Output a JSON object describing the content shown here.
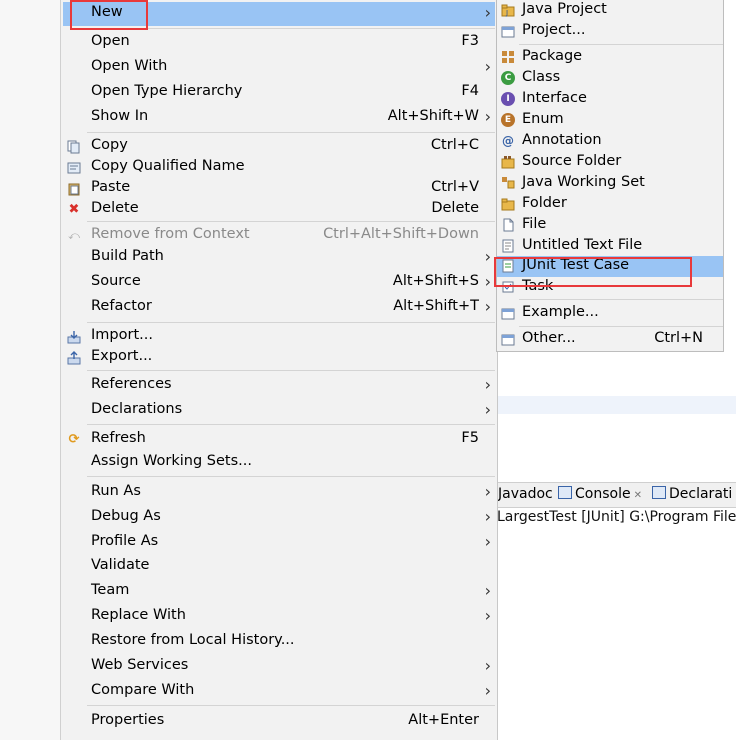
{
  "menu": {
    "items": [
      {
        "label": "New",
        "accel": "",
        "arrow": true,
        "icon": "",
        "highlight": true
      },
      {
        "label": "Open",
        "accel": "F3",
        "arrow": false,
        "icon": ""
      },
      {
        "label": "Open With",
        "accel": "",
        "arrow": true,
        "icon": ""
      },
      {
        "label": "Open Type Hierarchy",
        "accel": "F4",
        "arrow": false,
        "icon": ""
      },
      {
        "label": "Show In",
        "accel": "Alt+Shift+W",
        "arrow": true,
        "icon": ""
      },
      {
        "label": "Copy",
        "accel": "Ctrl+C",
        "arrow": false,
        "icon": "copy-icon"
      },
      {
        "label": "Copy Qualified Name",
        "accel": "",
        "arrow": false,
        "icon": "copy-qualified-name-icon"
      },
      {
        "label": "Paste",
        "accel": "Ctrl+V",
        "arrow": false,
        "icon": "paste-icon"
      },
      {
        "label": "Delete",
        "accel": "Delete",
        "arrow": false,
        "icon": "delete-icon"
      },
      {
        "label": "Remove from Context",
        "accel": "Ctrl+Alt+Shift+Down",
        "arrow": false,
        "icon": "remove-context-icon",
        "disabled": true
      },
      {
        "label": "Build Path",
        "accel": "",
        "arrow": true,
        "icon": ""
      },
      {
        "label": "Source",
        "accel": "Alt+Shift+S",
        "arrow": true,
        "icon": ""
      },
      {
        "label": "Refactor",
        "accel": "Alt+Shift+T",
        "arrow": true,
        "icon": ""
      },
      {
        "label": "Import...",
        "accel": "",
        "arrow": false,
        "icon": "import-icon"
      },
      {
        "label": "Export...",
        "accel": "",
        "arrow": false,
        "icon": "export-icon"
      },
      {
        "label": "References",
        "accel": "",
        "arrow": true,
        "icon": ""
      },
      {
        "label": "Declarations",
        "accel": "",
        "arrow": true,
        "icon": ""
      },
      {
        "label": "Refresh",
        "accel": "F5",
        "arrow": false,
        "icon": "refresh-icon"
      },
      {
        "label": "Assign Working Sets...",
        "accel": "",
        "arrow": false,
        "icon": ""
      },
      {
        "label": "Run As",
        "accel": "",
        "arrow": true,
        "icon": ""
      },
      {
        "label": "Debug As",
        "accel": "",
        "arrow": true,
        "icon": ""
      },
      {
        "label": "Profile As",
        "accel": "",
        "arrow": true,
        "icon": ""
      },
      {
        "label": "Validate",
        "accel": "",
        "arrow": false,
        "icon": ""
      },
      {
        "label": "Team",
        "accel": "",
        "arrow": true,
        "icon": ""
      },
      {
        "label": "Replace With",
        "accel": "",
        "arrow": true,
        "icon": ""
      },
      {
        "label": "Restore from Local History...",
        "accel": "",
        "arrow": false,
        "icon": ""
      },
      {
        "label": "Web Services",
        "accel": "",
        "arrow": true,
        "icon": ""
      },
      {
        "label": "Compare With",
        "accel": "",
        "arrow": true,
        "icon": ""
      },
      {
        "label": "Properties",
        "accel": "Alt+Enter",
        "arrow": false,
        "icon": ""
      }
    ]
  },
  "submenu": {
    "items": [
      {
        "label": "Java Project",
        "accel": "",
        "icon": "java-project-icon"
      },
      {
        "label": "Project...",
        "accel": "",
        "icon": "project-icon"
      },
      {
        "label": "Package",
        "accel": "",
        "icon": "package-icon"
      },
      {
        "label": "Class",
        "accel": "",
        "icon": "class-icon"
      },
      {
        "label": "Interface",
        "accel": "",
        "icon": "interface-icon"
      },
      {
        "label": "Enum",
        "accel": "",
        "icon": "enum-icon"
      },
      {
        "label": "Annotation",
        "accel": "",
        "icon": "annotation-icon"
      },
      {
        "label": "Source Folder",
        "accel": "",
        "icon": "source-folder-icon"
      },
      {
        "label": "Java Working Set",
        "accel": "",
        "icon": "working-set-icon"
      },
      {
        "label": "Folder",
        "accel": "",
        "icon": "folder-icon"
      },
      {
        "label": "File",
        "accel": "",
        "icon": "file-icon"
      },
      {
        "label": "Untitled Text File",
        "accel": "",
        "icon": "text-file-icon"
      },
      {
        "label": "JUnit Test Case",
        "accel": "",
        "icon": "junit-icon",
        "highlight": true
      },
      {
        "label": "Task",
        "accel": "",
        "icon": "task-icon"
      },
      {
        "label": "Example...",
        "accel": "",
        "icon": "example-icon"
      },
      {
        "label": "Other...",
        "accel": "Ctrl+N",
        "icon": "other-icon"
      }
    ]
  },
  "background": {
    "tabs": [
      {
        "label": "Javadoc",
        "icon": ""
      },
      {
        "label": "Console",
        "icon": "console-icon"
      },
      {
        "label": "Declarati",
        "icon": "declaration-icon"
      }
    ],
    "console_line": "LargestTest [JUnit] G:\\Program File"
  },
  "colors": {
    "highlight": "#99c4f4",
    "annotation_box": "#e8393b",
    "menu_bg": "#f2f2f2"
  }
}
